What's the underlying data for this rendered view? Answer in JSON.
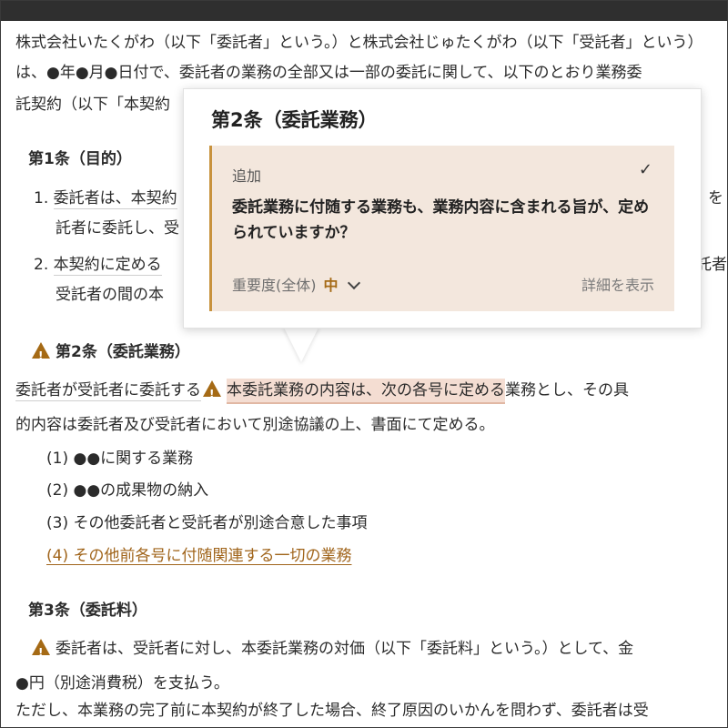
{
  "document": {
    "preamble": [
      "株式会社いたくがわ（以下「委託者」という。）と株式会社じゅたくがわ（以下「受託者」という）",
      "は、●年●月●日付で、委託者の業務の全部又は一部の委託に関して、以下のとおり業務委",
      "託契約（以下「本契約"
    ],
    "article1": {
      "title": "第1条（目的）",
      "item1_num": "1.",
      "item1_a": "委託者は、本契約",
      "item1_tail": "）を",
      "item1_b": "託者に委託し、受",
      "item2_num": "2.",
      "item2_a": "本契約に定める",
      "item2_tail": "託者",
      "item2_b": "受託者の間の本"
    },
    "article2": {
      "title": "第2条（委託業務）",
      "body_pre": "委託者が受託者に委託する",
      "body_highlight": "本委託業務の内容は、次の各号に定める",
      "body_post": "業務とし、その具",
      "body_line2": "的内容は委託者及び受託者において別途協議の上、書面にて定める。",
      "list": [
        "(1) ●●に関する業務",
        "(2) ●●の成果物の納入",
        "(3) その他委託者と受託者が別途合意した事項"
      ],
      "added_item": "(4) その他前各号に付随関連する一切の業務"
    },
    "article3": {
      "title": "第3条（委託料）",
      "line1": "委託者は、受託者に対し、本委託業務の対価（以下「委託料」という。）として、金",
      "line2": "●円（別途消費税）を支払う。",
      "line3": "ただし、本業務の完了前に本契約が終了した場合、終了原因のいかんを問わず、委託者は受"
    }
  },
  "popover": {
    "title": "第2条（委託業務）",
    "card": {
      "label": "追加",
      "check_icon": "check-icon",
      "question": "委託業務に付随する業務も、業務内容に含まれる旨が、定められていますか？",
      "importance_label": "重要度(全体)",
      "importance_value": "中",
      "details_link": "詳細を表示"
    }
  },
  "colors": {
    "accent": "#a56a15",
    "highlight": "#f4ddd2",
    "card_bg": "#f3e7dd"
  }
}
